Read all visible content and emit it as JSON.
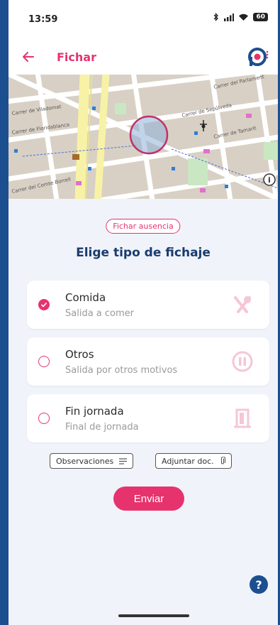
{
  "status": {
    "time": "13:59",
    "battery": "60"
  },
  "appbar": {
    "title": "Fichar"
  },
  "map": {
    "streets": [
      "Carrer de Sepúlveda",
      "Carrer de Tamarit",
      "Carrer del Parlament",
      "Carrer de Viladomat",
      "Carrer de Floridablanca",
      "Carrer del Comte Borrell"
    ]
  },
  "absence_button": "Fichar ausencia",
  "heading": "Elige tipo de fichaje",
  "options": [
    {
      "title": "Comida",
      "subtitle": "Salida a comer",
      "selected": true,
      "icon": "utensils-icon"
    },
    {
      "title": "Otros",
      "subtitle": "Salida por otros motivos",
      "selected": false,
      "icon": "pause-icon"
    },
    {
      "title": "Fin jornada",
      "subtitle": "Final de jornada",
      "selected": false,
      "icon": "door-icon"
    }
  ],
  "actions": {
    "observations": "Observaciones",
    "attach": "Adjuntar doc.",
    "send": "Enviar"
  },
  "help": "?",
  "colors": {
    "accent": "#e6336e",
    "navy": "#1a3c6e",
    "frame": "#1c4f8f"
  }
}
